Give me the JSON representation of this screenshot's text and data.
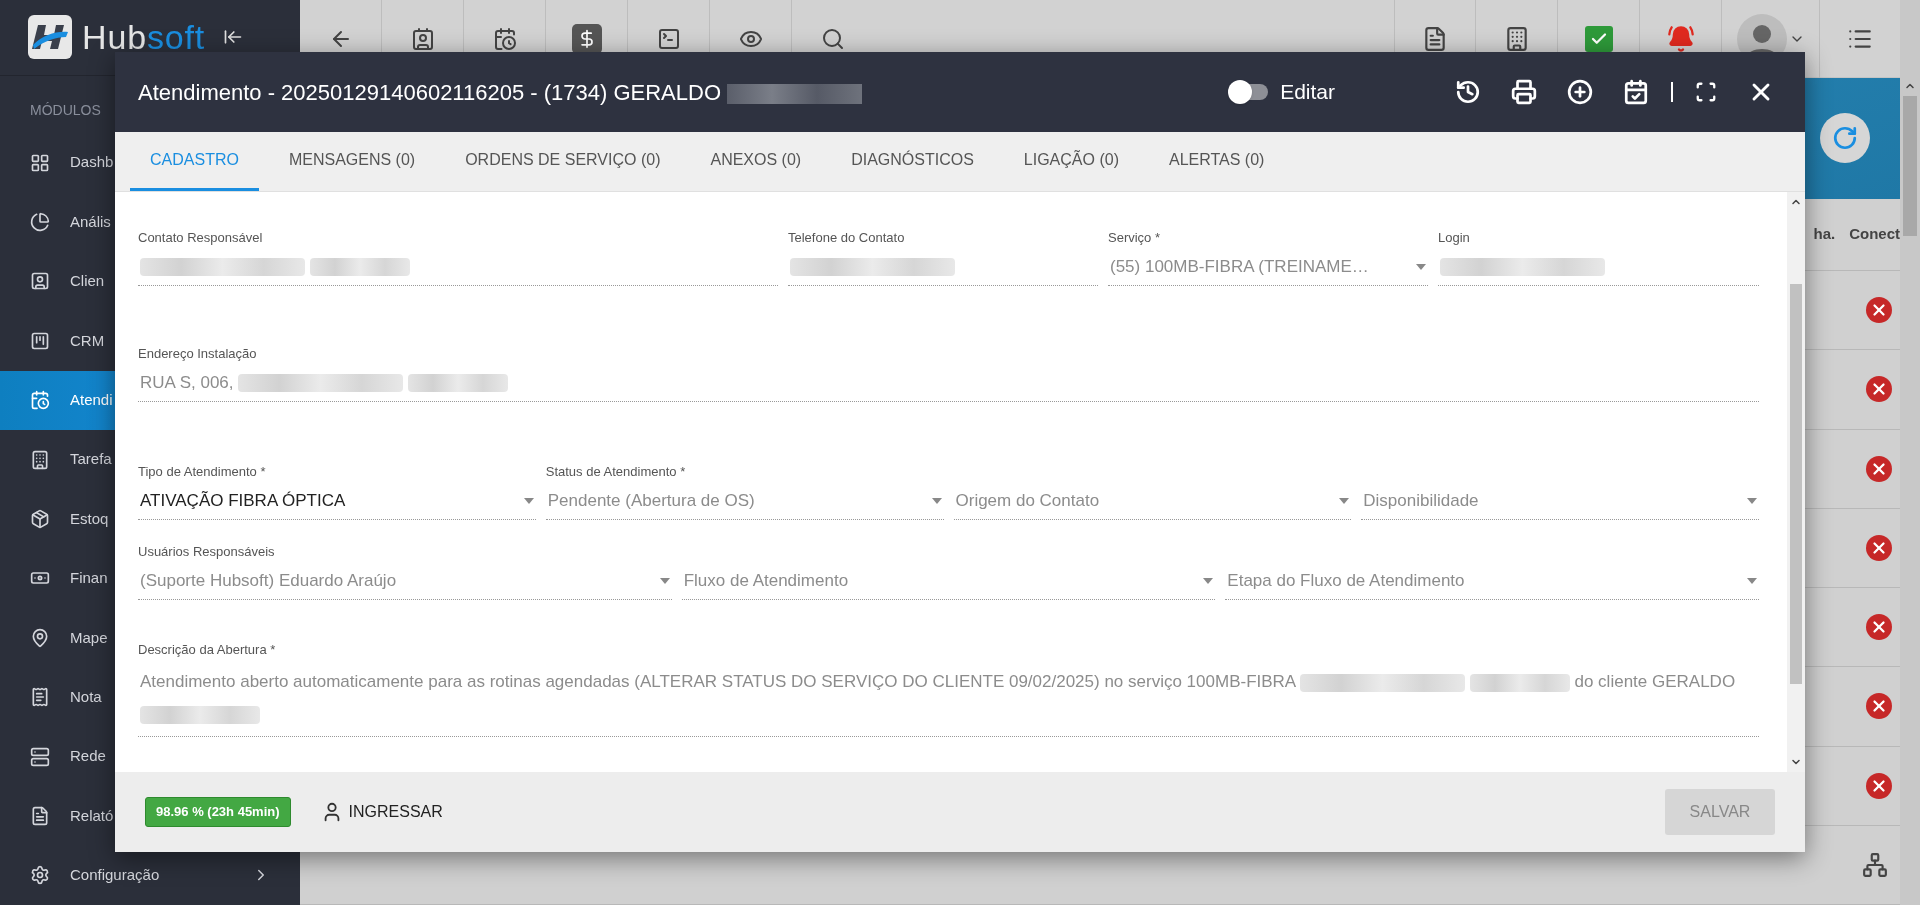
{
  "sidebar": {
    "logo": {
      "part_1": "Hub",
      "part_2": "soft"
    },
    "section_label": "MÓDULOS",
    "items": [
      {
        "label": "Dashb",
        "selected": false
      },
      {
        "label": "Anális",
        "selected": false
      },
      {
        "label": "Clien",
        "selected": false
      },
      {
        "label": "CRM",
        "selected": false
      },
      {
        "label": "Atendi",
        "selected": true
      },
      {
        "label": "Tarefa",
        "selected": false
      },
      {
        "label": "Estoq",
        "selected": false
      },
      {
        "label": "Finan",
        "selected": false
      },
      {
        "label": "Mape",
        "selected": false
      },
      {
        "label": "Nota",
        "selected": false
      },
      {
        "label": "Rede",
        "selected": false
      },
      {
        "label": "Relató",
        "selected": false
      },
      {
        "label": "Configuração",
        "selected": false,
        "has_submenu": true
      }
    ]
  },
  "background_table": {
    "columns": [
      "ha.",
      "Conect"
    ],
    "rows": [
      {
        "kind": "offline"
      },
      {
        "kind": "offline"
      },
      {
        "kind": "offline"
      },
      {
        "kind": "offline"
      },
      {
        "kind": "offline"
      },
      {
        "kind": "offline"
      },
      {
        "kind": "offline"
      },
      {
        "kind": "network"
      }
    ]
  },
  "modal": {
    "title": "Atendimento - 20250129140602116205 - (1734) GERALDO",
    "title_redacted": true,
    "edit_toggle": {
      "label": "Editar",
      "on": false
    },
    "tabs": [
      {
        "label": "CADASTRO",
        "selected": true
      },
      {
        "label": "MENSAGENS (0)",
        "selected": false
      },
      {
        "label": "ORDENS DE SERVIÇO (0)",
        "selected": false
      },
      {
        "label": "ANEXOS (0)",
        "selected": false
      },
      {
        "label": "DIAGNÓSTICOS",
        "selected": false
      },
      {
        "label": "LIGAÇÃO (0)",
        "selected": false
      },
      {
        "label": "ALERTAS (0)",
        "selected": false
      }
    ],
    "rows": [
      {
        "fields": [
          {
            "label": "Contato Responsável",
            "kind": "text",
            "segments": [
              {
                "kind": "redacted"
              },
              {
                "kind": "redacted"
              }
            ]
          },
          {
            "label": "Telefone do Contato",
            "kind": "text",
            "segments": [
              {
                "kind": "redacted"
              }
            ]
          },
          {
            "label": "Serviço *",
            "kind": "select",
            "disabled": true,
            "segments": [
              {
                "kind": "text",
                "text": "(55) 100MB-FIBRA (TREINAME…"
              }
            ]
          },
          {
            "label": "Login",
            "kind": "text",
            "segments": [
              {
                "kind": "redacted"
              }
            ]
          }
        ]
      },
      {
        "fields": [
          {
            "label": "Endereço Instalação",
            "kind": "text",
            "disabled": true,
            "segments": [
              {
                "kind": "text",
                "text": "RUA S, 006,"
              },
              {
                "kind": "redacted"
              },
              {
                "kind": "redacted"
              }
            ]
          }
        ]
      },
      {
        "fields": [
          {
            "label": "Tipo de Atendimento *",
            "kind": "select",
            "disabled": false,
            "segments": [
              {
                "kind": "text",
                "text": "ATIVAÇÃO FIBRA ÓPTICA"
              }
            ]
          },
          {
            "label": "Status de Atendimento *",
            "kind": "select",
            "disabled": true,
            "segments": [
              {
                "kind": "text",
                "text": "Pendente (Abertura de OS)"
              }
            ]
          },
          {
            "kind": "select",
            "placeholder": "Origem do Contato"
          },
          {
            "kind": "select",
            "placeholder": "Disponibilidade"
          }
        ]
      },
      {
        "fields": [
          {
            "label": "Usuários Responsáveis",
            "kind": "select",
            "disabled": true,
            "segments": [
              {
                "kind": "text",
                "text": "(Suporte Hubsoft) Eduardo Araújo"
              }
            ]
          },
          {
            "kind": "select",
            "placeholder": "Fluxo de Atendimento"
          },
          {
            "kind": "select",
            "placeholder": "Etapa do Fluxo de Atendimento"
          }
        ]
      },
      {
        "fields": [
          {
            "label": "Descrição da Abertura *",
            "kind": "textarea",
            "disabled": true,
            "segments": [
              {
                "kind": "text",
                "text": "Atendimento aberto automaticamente para as rotinas agendadas (ALTERAR STATUS DO SERVIÇO DO CLIENTE 09/02/2025) no serviço 100MB-FIBRA"
              },
              {
                "kind": "redacted"
              },
              {
                "kind": "redacted"
              },
              {
                "kind": "text",
                "text": "do cliente GERALDO"
              },
              {
                "kind": "redacted"
              }
            ]
          }
        ]
      }
    ],
    "footer": {
      "uptime_badge": "98.96 % (23h 45min)",
      "join_button": "INGRESSAR",
      "save_button": {
        "label": "SALVAR",
        "disabled": true
      }
    }
  }
}
